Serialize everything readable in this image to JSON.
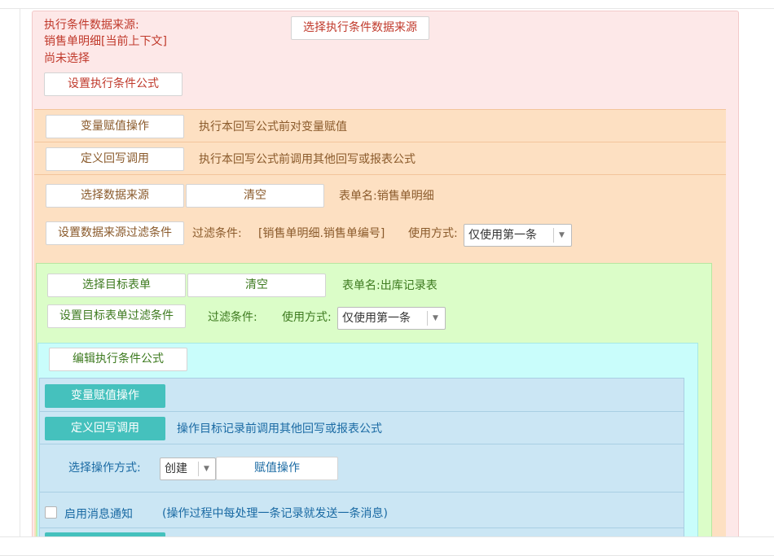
{
  "colors": {
    "pink_panel": "#fde8e8",
    "orange_panel": "#fde0c2",
    "green_panel": "#dbfdc8",
    "cyan_panel": "#c9fdfb",
    "blue_panel": "#cbe6f4",
    "teal_button": "#45c1bd"
  },
  "condition": {
    "source_label": "执行条件数据来源:",
    "source_value": "销售单明细[当前上下文]",
    "status": "尚未选择",
    "choose_source_button": "选择执行条件数据来源",
    "set_formula_button": "设置执行条件公式"
  },
  "writeback": {
    "var_assign_button": "变量赋值操作",
    "var_assign_desc": "执行本回写公式前对变量赋值",
    "define_call_button": "定义回写调用",
    "define_call_desc": "执行本回写公式前调用其他回写或报表公式",
    "choose_source_button": "选择数据来源",
    "clear_button": "清空",
    "table_name": "表单名:销售单明细",
    "filter_button": "设置数据来源过滤条件",
    "filter_label": "过滤条件:",
    "filter_value": "[销售单明细.销售单编号]",
    "usage_label": "使用方式:",
    "usage_value": "仅使用第一条"
  },
  "target": {
    "choose_target_button": "选择目标表单",
    "clear_button": "清空",
    "table_name": "表单名:出库记录表",
    "filter_button": "设置目标表单过滤条件",
    "filter_label": "过滤条件:",
    "usage_label": "使用方式:",
    "usage_value": "仅使用第一条"
  },
  "exec_condition": {
    "edit_formula_button": "编辑执行条件公式"
  },
  "operations": {
    "var_assign_button": "变量赋值操作",
    "define_call_button": "定义回写调用",
    "define_call_desc": "操作目标记录前调用其他回写或报表公式",
    "op_mode_label": "选择操作方式:",
    "op_mode_value": "创建",
    "assign_button": "赋值操作",
    "notify_label": "启用消息通知",
    "notify_desc": "(操作过程中每处理一条记录就发送一条消息)",
    "notify_checked": false
  }
}
